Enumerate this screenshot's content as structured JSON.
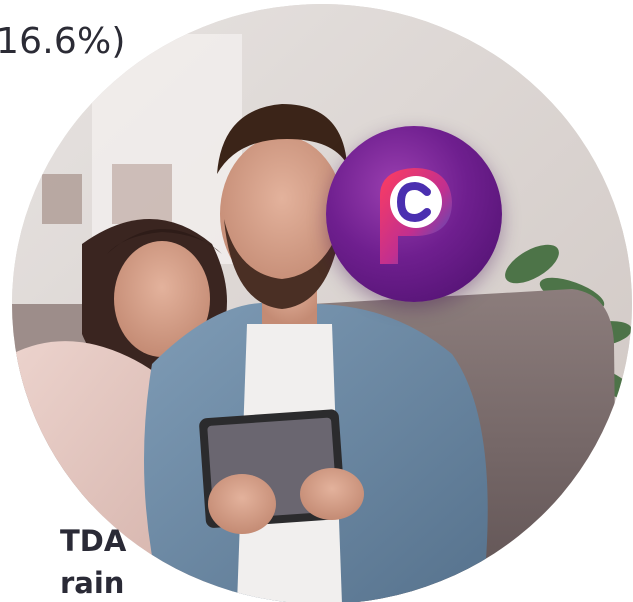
{
  "stat": {
    "percent_text": "16.6%)"
  },
  "bottom_caption": {
    "line1": "TDA",
    "line2": "rain"
  },
  "colors": {
    "text_dark": "#2b2b35",
    "badge_purple": "#6f1f8f",
    "badge_logo_pink": "#e8336a",
    "badge_logo_blue": "#2b55c8"
  },
  "icons": {
    "app_badge": "app-logo-icon"
  }
}
